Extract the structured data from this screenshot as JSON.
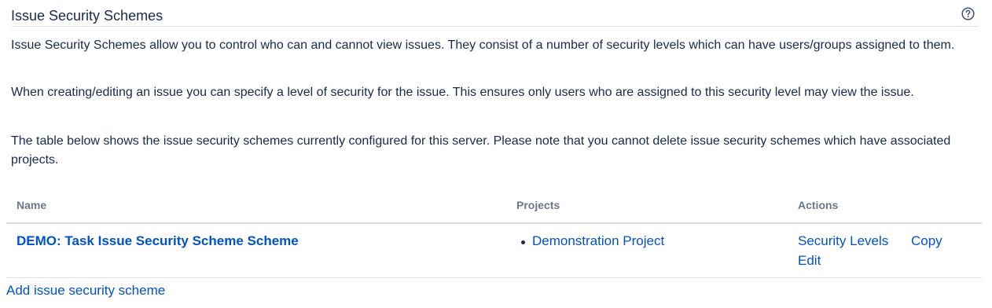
{
  "header": {
    "title": "Issue Security Schemes",
    "help_icon": "question-circle-icon"
  },
  "description": {
    "p1": "Issue Security Schemes allow you to control who can and cannot view issues. They consist of a number of security levels which can have users/groups assigned to them.",
    "p2": "When creating/editing an issue you can specify a level of security for the issue. This ensures only users who are assigned to this security level may view the issue.",
    "p3": "The table below shows the issue security schemes currently configured for this server. Please note that you cannot delete issue security schemes which have associated projects."
  },
  "table": {
    "columns": [
      "Name",
      "Projects",
      "Actions"
    ],
    "rows": [
      {
        "name": "DEMO: Task Issue Security Scheme Scheme",
        "projects": [
          "Demonstration Project"
        ],
        "actions": [
          "Security Levels",
          "Copy",
          "Edit"
        ]
      }
    ]
  },
  "footer": {
    "add_label": "Add issue security scheme"
  },
  "colors": {
    "link": "#0052cc",
    "text": "#172b4d",
    "header_text": "#6b778c",
    "border": "#dfe1e6"
  }
}
